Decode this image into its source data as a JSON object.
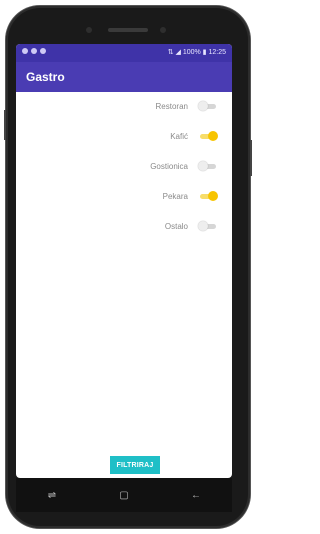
{
  "status_bar": {
    "left_icons": [
      "notification-icon",
      "notification-icon",
      "notification-icon"
    ],
    "right_text": "⇅ ◢ 100% ▮ 12:25",
    "battery": "100%",
    "time": "12:25"
  },
  "app_bar": {
    "title": "Gastro",
    "color": "#4a3cb3"
  },
  "toggles": [
    {
      "label": "Restoran",
      "on": false
    },
    {
      "label": "Kafić",
      "on": true
    },
    {
      "label": "Gostionica",
      "on": false
    },
    {
      "label": "Pekara",
      "on": true
    },
    {
      "label": "Ostalo",
      "on": false
    }
  ],
  "filter_button": {
    "label": "FILTRIRAJ",
    "color": "#1fbfc7"
  },
  "nav_bar": {
    "icons": [
      "recent-apps-icon",
      "home-icon",
      "back-icon"
    ]
  },
  "accent_color": "#f7c400"
}
